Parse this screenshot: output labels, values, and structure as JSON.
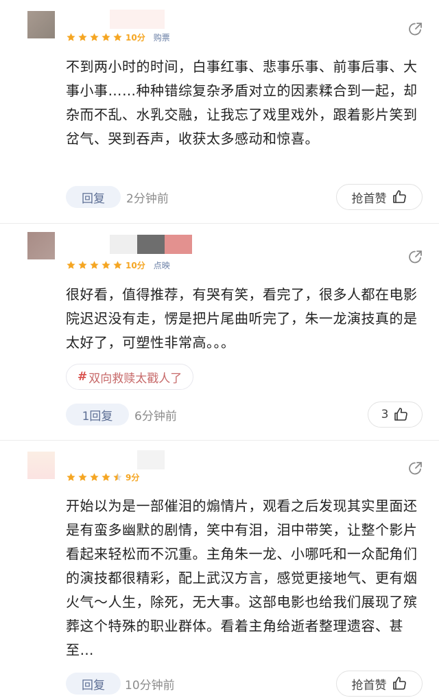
{
  "colors": {
    "star": "#f5a623",
    "tag": "#6a7fa6",
    "hashtag": "#c76a6a",
    "reply_bg": "#eef2f9",
    "reply_text": "#5d6f95"
  },
  "comments": [
    {
      "score": "10分",
      "source": "购票",
      "stars": 5,
      "text": "不到两小时的时间，白事红事、悲事乐事、前事后事、大事小事……种种错综复杂矛盾对立的因素糅合到一起，却杂而不乱、水乳交融，让我忘了戏里戏外，跟着影片笑到岔气、哭到吞声，收获太多感动和惊喜。",
      "reply_label": "回复",
      "time": "2分钟前",
      "like_label": "抢首赞",
      "icons": [
        "share-icon",
        "thumbs-up-icon"
      ]
    },
    {
      "score": "10分",
      "source": "点映",
      "stars": 5,
      "text": "很好看，值得推荐，有哭有笑，看完了，很多人都在电影院迟迟没有走，愣是把片尾曲听完了，朱一龙演技真的是太好了，可塑性非常高。。。",
      "hashtag": "双向救赎太戳人了",
      "reply_label": "1回复",
      "time": "6分钟前",
      "like_label": "3",
      "icons": [
        "share-icon",
        "thumbs-up-icon"
      ]
    },
    {
      "score": "9分",
      "source": "",
      "stars": 4.5,
      "text": "开始以为是一部催泪的煽情片，观看之后发现其实里面还是有蛮多幽默的剧情，笑中有泪，泪中带笑，让整个影片看起来轻松而不沉重。主角朱一龙、小哪吒和一众配角们的演技都很精彩，配上武汉方言，感觉更接地气、更有烟火气～人生，除死，无大事。这部电影也给我们展现了殡葬这个特殊的职业群体。看着主角给逝者整理遗容、甚至…",
      "reply_label": "回复",
      "time": "10分钟前",
      "like_label": "抢首赞",
      "icons": [
        "share-icon",
        "thumbs-up-icon"
      ]
    }
  ]
}
